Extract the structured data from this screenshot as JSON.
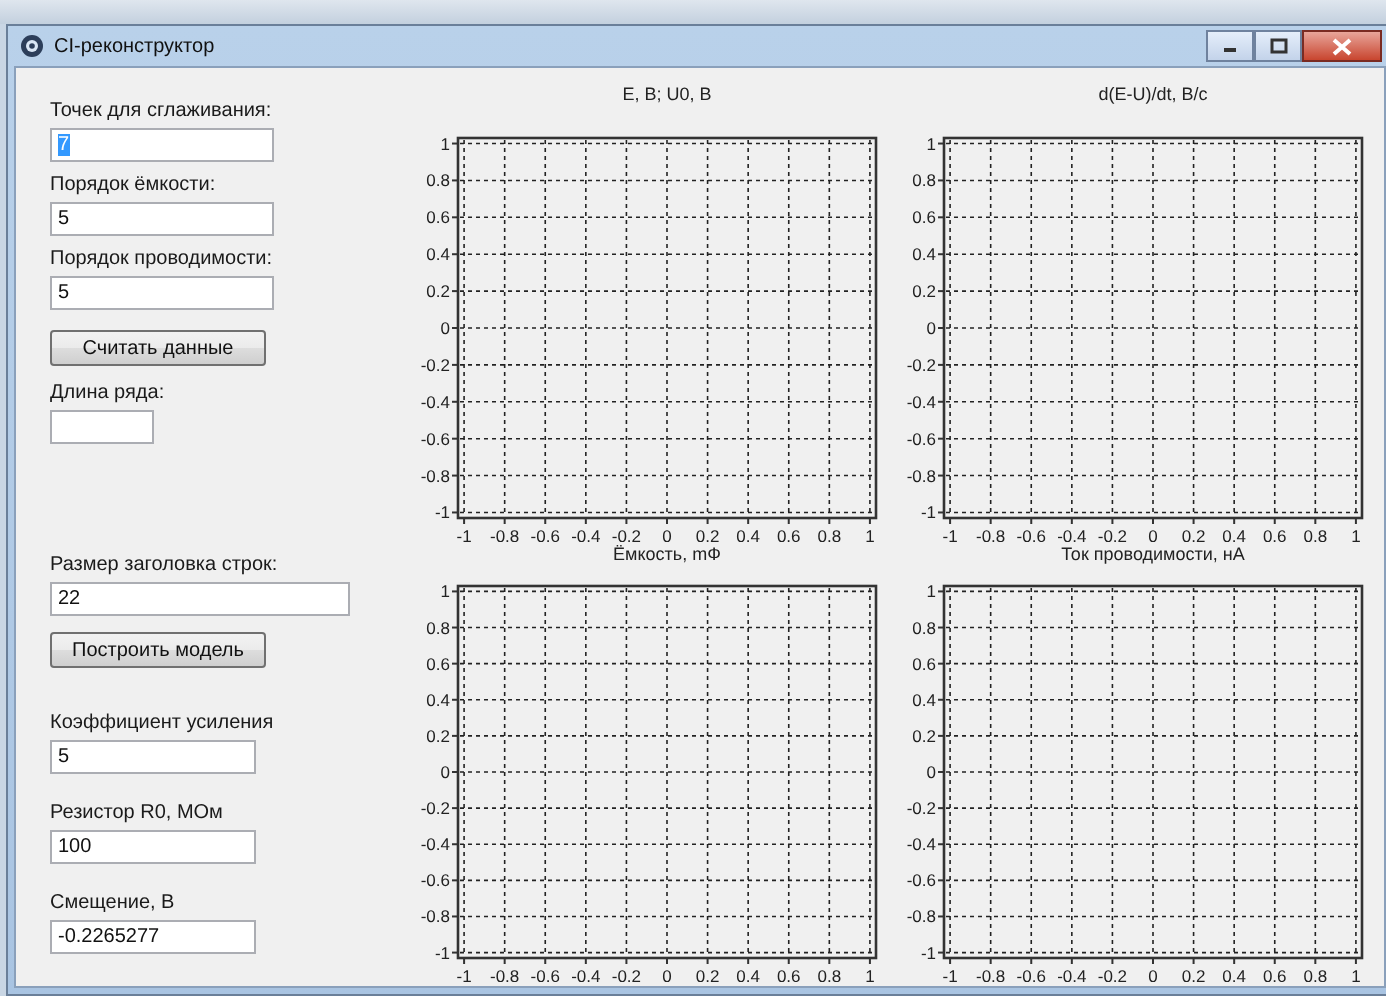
{
  "window": {
    "title": "CI-реконструктор"
  },
  "form": [
    {
      "kind": "field",
      "label": "Точек для сглаживания:",
      "value": "7",
      "text_selected": true
    },
    {
      "kind": "field",
      "label": "Порядок ёмкости:",
      "value": "5",
      "text_selected": false
    },
    {
      "kind": "field",
      "label": "Порядок проводимости:",
      "value": "5",
      "text_selected": false
    },
    {
      "kind": "button",
      "label": "Считать данные"
    },
    {
      "kind": "field",
      "label": "Длина ряда:"
    },
    {
      "kind": "field",
      "label": "Размер заголовка строк:",
      "value": "22",
      "text_selected": false
    },
    {
      "kind": "button",
      "label": "Построить модель"
    },
    {
      "kind": "field",
      "label": "Коэффициент усиления",
      "value": "5",
      "text_selected": false
    },
    {
      "kind": "field",
      "label": "Резистор R0, МОм",
      "value": "100",
      "text_selected": false
    },
    {
      "kind": "field",
      "label": "Смещение, В",
      "value": "-0.2265277",
      "text_selected": false
    }
  ],
  "charts": [
    {
      "chart_data": {
        "type": "line",
        "title": "E, B; U0, B",
        "grid": true,
        "xlim": [
          -1.03,
          1.03
        ],
        "ylim": [
          -1.03,
          1.03
        ],
        "xticks": [
          -1,
          -0.8,
          -0.6,
          -0.4,
          -0.2,
          0,
          0.2,
          0.4,
          0.6,
          0.8,
          1
        ],
        "yticks": [
          -1,
          -0.8,
          -0.6,
          -0.4,
          -0.2,
          0,
          0.2,
          0.4,
          0.6,
          0.8,
          1
        ]
      }
    },
    {
      "chart_data": {
        "type": "line",
        "title": "d(E-U)/dt, B/c",
        "grid": true,
        "xlim": [
          -1.03,
          1.03
        ],
        "ylim": [
          -1.03,
          1.03
        ],
        "xticks": [
          -1,
          -0.8,
          -0.6,
          -0.4,
          -0.2,
          0,
          0.2,
          0.4,
          0.6,
          0.8,
          1
        ],
        "yticks": [
          -1,
          -0.8,
          -0.6,
          -0.4,
          -0.2,
          0,
          0.2,
          0.4,
          0.6,
          0.8,
          1
        ]
      }
    },
    {
      "chart_data": {
        "type": "line",
        "title": "Ёмкость, mФ",
        "grid": true,
        "xlim": [
          -1.03,
          1.03
        ],
        "ylim": [
          -1.03,
          1.03
        ],
        "xticks": [
          -1,
          -0.8,
          -0.6,
          -0.4,
          -0.2,
          0,
          0.2,
          0.4,
          0.6,
          0.8,
          1
        ],
        "yticks": [
          -1,
          -0.8,
          -0.6,
          -0.4,
          -0.2,
          0,
          0.2,
          0.4,
          0.6,
          0.8,
          1
        ]
      }
    },
    {
      "chart_data": {
        "type": "line",
        "title": "Ток проводимости, нА",
        "grid": true,
        "xlim": [
          -1.03,
          1.03
        ],
        "ylim": [
          -1.03,
          1.03
        ],
        "xticks": [
          -1,
          -0.8,
          -0.6,
          -0.4,
          -0.2,
          0,
          0.2,
          0.4,
          0.6,
          0.8,
          1
        ],
        "yticks": [
          -1,
          -0.8,
          -0.6,
          -0.4,
          -0.2,
          0,
          0.2,
          0.4,
          0.6,
          0.8,
          1
        ]
      }
    }
  ]
}
